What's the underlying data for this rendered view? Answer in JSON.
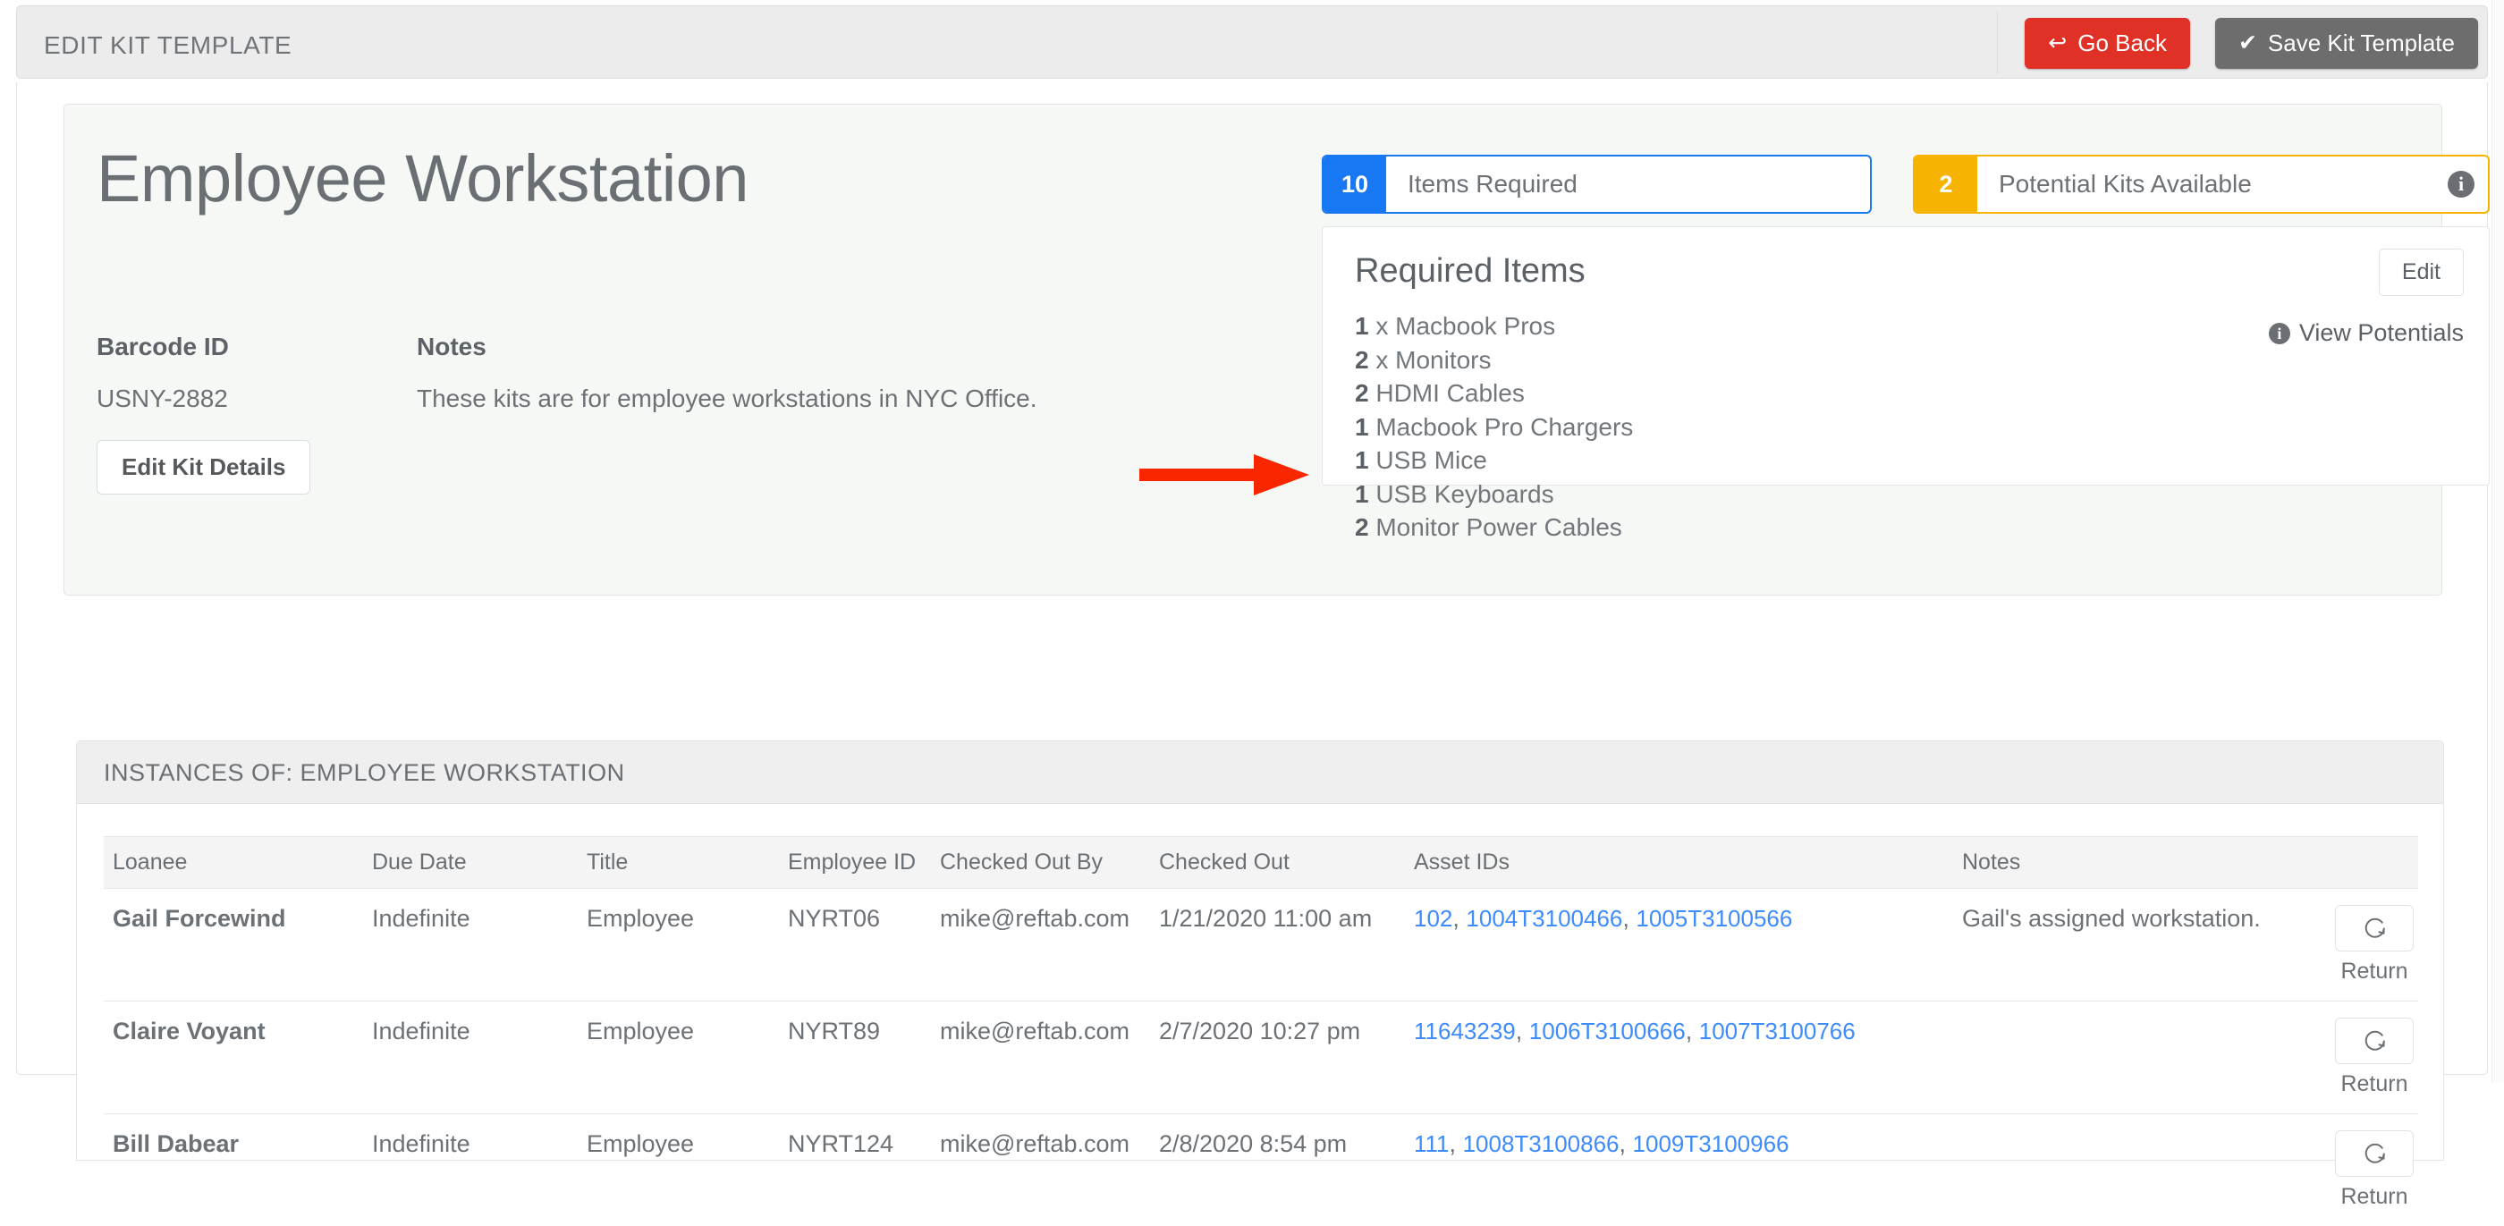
{
  "topbar": {
    "title": "EDIT KIT TEMPLATE",
    "go_back_label": "Go Back",
    "go_back_icon": "undo-arrow-icon",
    "save_label": "Save Kit Template",
    "save_icon": "checkmark-icon",
    "go_back_color": "#e03127",
    "save_color": "#6d6d6d"
  },
  "kit": {
    "title": "Employee Workstation",
    "barcode_label": "Barcode ID",
    "barcode_value": "USNY-2882",
    "notes_label": "Notes",
    "notes_value": "These kits are for employee workstations in NYC Office.",
    "edit_details_label": "Edit Kit Details"
  },
  "stats": [
    {
      "count": "10",
      "label": "Items Required",
      "color": "#1877f2",
      "has_info": false
    },
    {
      "count": "2",
      "label": "Potential Kits Available",
      "color": "#f6b400",
      "has_info": true
    }
  ],
  "required_items": {
    "title": "Required Items",
    "edit_label": "Edit",
    "view_potentials_label": "View Potentials",
    "items": [
      {
        "qty": "1",
        "name": "x Macbook Pros"
      },
      {
        "qty": "2",
        "name": "x Monitors"
      },
      {
        "qty": "2",
        "name": "HDMI Cables"
      },
      {
        "qty": "1",
        "name": "Macbook Pro Chargers"
      },
      {
        "qty": "1",
        "name": "USB Mice"
      },
      {
        "qty": "1",
        "name": "USB Keyboards"
      },
      {
        "qty": "2",
        "name": "Monitor Power Cables"
      }
    ]
  },
  "annotation": {
    "type": "red-arrow",
    "color": "#fa2600",
    "points_at": "Macbook Pro Chargers"
  },
  "instances": {
    "header": "INSTANCES OF: EMPLOYEE WORKSTATION",
    "columns": [
      "Loanee",
      "Due Date",
      "Title",
      "Employee ID",
      "Checked Out By",
      "Checked Out",
      "Asset IDs",
      "Notes",
      ""
    ],
    "return_label": "Return",
    "return_icon": "refresh-circular-arrow-icon",
    "rows": [
      {
        "loanee": "Gail Forcewind",
        "due_date": "Indefinite",
        "title": "Employee",
        "employee_id": "NYRT06",
        "checked_out_by": "mike@reftab.com",
        "checked_out": "1/21/2020 11:00 am",
        "asset_ids": [
          "102",
          "1004T3100466",
          "1005T3100566"
        ],
        "notes": "Gail's assigned workstation."
      },
      {
        "loanee": "Claire Voyant",
        "due_date": "Indefinite",
        "title": "Employee",
        "employee_id": "NYRT89",
        "checked_out_by": "mike@reftab.com",
        "checked_out": "2/7/2020 10:27 pm",
        "asset_ids": [
          "11643239",
          "1006T3100666",
          "1007T3100766"
        ],
        "notes": ""
      },
      {
        "loanee": "Bill Dabear",
        "due_date": "Indefinite",
        "title": "Employee",
        "employee_id": "NYRT124",
        "checked_out_by": "mike@reftab.com",
        "checked_out": "2/8/2020 8:54 pm",
        "asset_ids": [
          "111",
          "1008T3100866",
          "1009T3100966"
        ],
        "notes": ""
      }
    ]
  }
}
